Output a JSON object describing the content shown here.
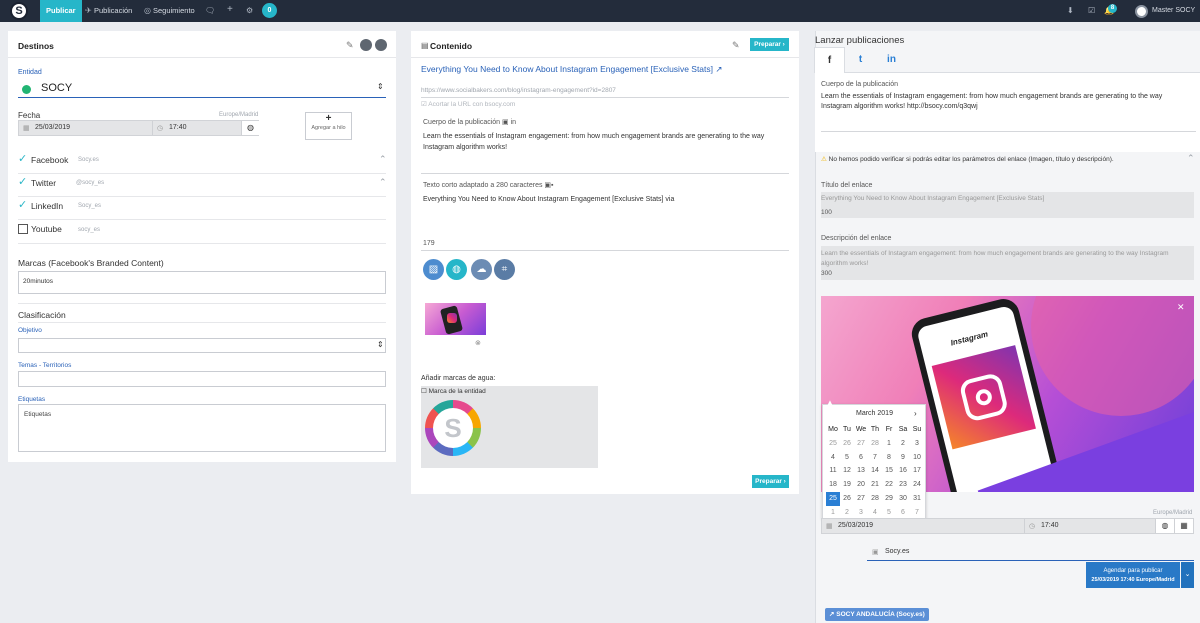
{
  "topbar": {
    "logo": "S",
    "nav": [
      "Publicar",
      "Publicación",
      "Seguimiento"
    ],
    "pending_count": "0",
    "notifications": "8",
    "user": "Master SOCY"
  },
  "destinos": {
    "title": "Destinos",
    "entidad_label": "Entidad",
    "entidad_value": "SOCY",
    "fecha_label": "Fecha",
    "timezone": "Europe/Madrid",
    "date": "25/03/2019",
    "time": "17:40",
    "add_thread": "Agregar a hilo",
    "networks": [
      {
        "name": "Facebook",
        "account": "Socy.es",
        "checked": true
      },
      {
        "name": "Twitter",
        "account": "@socy_es",
        "checked": true
      },
      {
        "name": "LinkedIn",
        "account": "Socy_es",
        "checked": true
      },
      {
        "name": "Youtube",
        "account": "socy_es",
        "checked": false
      }
    ],
    "marcas_label": "Marcas (Facebook's Branded Content)",
    "marcas_value": "20minutos",
    "clasificacion": "Clasificación",
    "objetivo_label": "Objetivo",
    "temas_label": "Temas - Territorios",
    "etiquetas_label": "Etiquetas",
    "etiquetas_placeholder": "Etiquetas"
  },
  "contenido": {
    "title": "Contenido",
    "prepare_button": "Preparar ›",
    "link_title": "Everything You Need to Know About Instagram Engagement [Exclusive Stats]",
    "url": "https://www.socialbakers.com/blog/instagram-engagement?id=2807",
    "shorten": "Acortar la URL con bsocy.com",
    "body_label": "Cuerpo de la publicación",
    "body_text": "Learn the essentials of Instagram engagement: from how much engagement brands are generating to the way Instagram algorithm works!",
    "short_label": "Texto corto adaptado a 280 caracteres",
    "short_text": "Everything You Need to Know About Instagram Engagement [Exclusive Stats] via",
    "char_count": "179",
    "watermark_label": "Añadir marcas de agua:",
    "watermark_option": "Marca de la entidad"
  },
  "lanzar": {
    "title": "Lanzar publicaciones",
    "body_label": "Cuerpo de la publicación",
    "body_text": "Learn the essentials of Instagram engagement: from how much engagement brands are generating to the way Instagram algorithm works! http://bsocy.com/q3qwj",
    "warning": "No hemos podido verificar si podrás editar los parámetros del enlace (Imagen, título y descripción).",
    "link_title_label": "Título del enlace",
    "link_title_value": "Everything You Need to Know About Instagram Engagement [Exclusive Stats]",
    "link_title_count": "100",
    "desc_label": "Descripción del enlace",
    "desc_value": "Learn the essentials of Instagram engagement: from how much engagement brands are generating to the way Instagram algorithm works!",
    "desc_count": "300",
    "phone_brand": "Instagram",
    "timezone": "Europe/Madrid",
    "date": "25/03/2019",
    "time": "17:40",
    "page_name": "Socy.es",
    "schedule_line1": "Agendar para publicar",
    "schedule_line2": "25/03/2019 17:40 Europe/Madrid",
    "bottom_tag": "SOCY ANDALUCÍA (Socy.es)"
  },
  "calendar": {
    "month": "March 2019",
    "days": [
      "Mo",
      "Tu",
      "We",
      "Th",
      "Fr",
      "Sa",
      "Su"
    ],
    "weeks": [
      [
        "25",
        "26",
        "27",
        "28",
        "1",
        "2",
        "3"
      ],
      [
        "4",
        "5",
        "6",
        "7",
        "8",
        "9",
        "10"
      ],
      [
        "11",
        "12",
        "13",
        "14",
        "15",
        "16",
        "17"
      ],
      [
        "18",
        "19",
        "20",
        "21",
        "22",
        "23",
        "24"
      ],
      [
        "25",
        "26",
        "27",
        "28",
        "29",
        "30",
        "31"
      ],
      [
        "1",
        "2",
        "3",
        "4",
        "5",
        "6",
        "7"
      ]
    ],
    "selected": "25"
  },
  "colors": {
    "topbar": "#232c3b",
    "accent": "#26b6c9",
    "link": "#2a62b8",
    "schedule": "#2979c7"
  }
}
